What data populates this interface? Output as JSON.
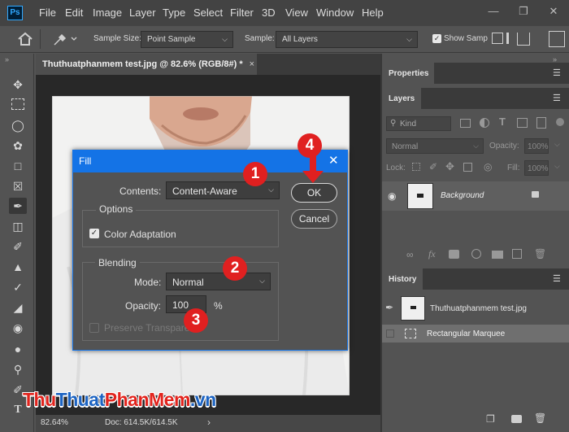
{
  "menu": {
    "logo": "Ps",
    "items": [
      "File",
      "Edit",
      "Image",
      "Layer",
      "Type",
      "Select",
      "Filter",
      "3D",
      "View",
      "Window",
      "Help"
    ]
  },
  "options": {
    "sample_size_label": "Sample Size:",
    "sample_size_value": "Point Sample",
    "sample_label": "Sample:",
    "sample_value": "All Layers",
    "show_sampling": "Show Samp"
  },
  "document": {
    "tab_title": "Thuthuatphanmem test.jpg @ 82.6% (RGB/8#) *",
    "zoom": "82.64%",
    "doc_info": "Doc: 614.5K/614.5K"
  },
  "panels": {
    "properties": "Properties",
    "layers": "Layers",
    "kind": "Kind",
    "blend_mode": "Normal",
    "opacity_label": "Opacity:",
    "opacity_value": "100%",
    "lock_label": "Lock:",
    "fill_label": "Fill:",
    "fill_value": "100%",
    "layer_name": "Background",
    "history": "History",
    "history_items": [
      "Thuthuatphanmem test.jpg",
      "Rectangular Marquee"
    ]
  },
  "dialog": {
    "title": "Fill",
    "contents_label": "Contents:",
    "contents_value": "Content-Aware",
    "options_label": "Options",
    "color_adaptation": "Color Adaptation",
    "blending_label": "Blending",
    "mode_label": "Mode:",
    "mode_value": "Normal",
    "opacity_label": "Opacity:",
    "opacity_value": "100",
    "opacity_unit": "%",
    "preserve_transparency": "Preserve Transpare",
    "ok": "OK",
    "cancel": "Cancel"
  },
  "badges": [
    "1",
    "2",
    "3",
    "4"
  ],
  "watermark": {
    "part1": "Thu",
    "part2": "Thuat",
    "part3": "PhanMem",
    "part4": ".vn"
  },
  "colors": {
    "accent": "#1473e6",
    "badge": "#e02020",
    "watermark_red": "#e2241d",
    "watermark_blue": "#1d64c2"
  }
}
